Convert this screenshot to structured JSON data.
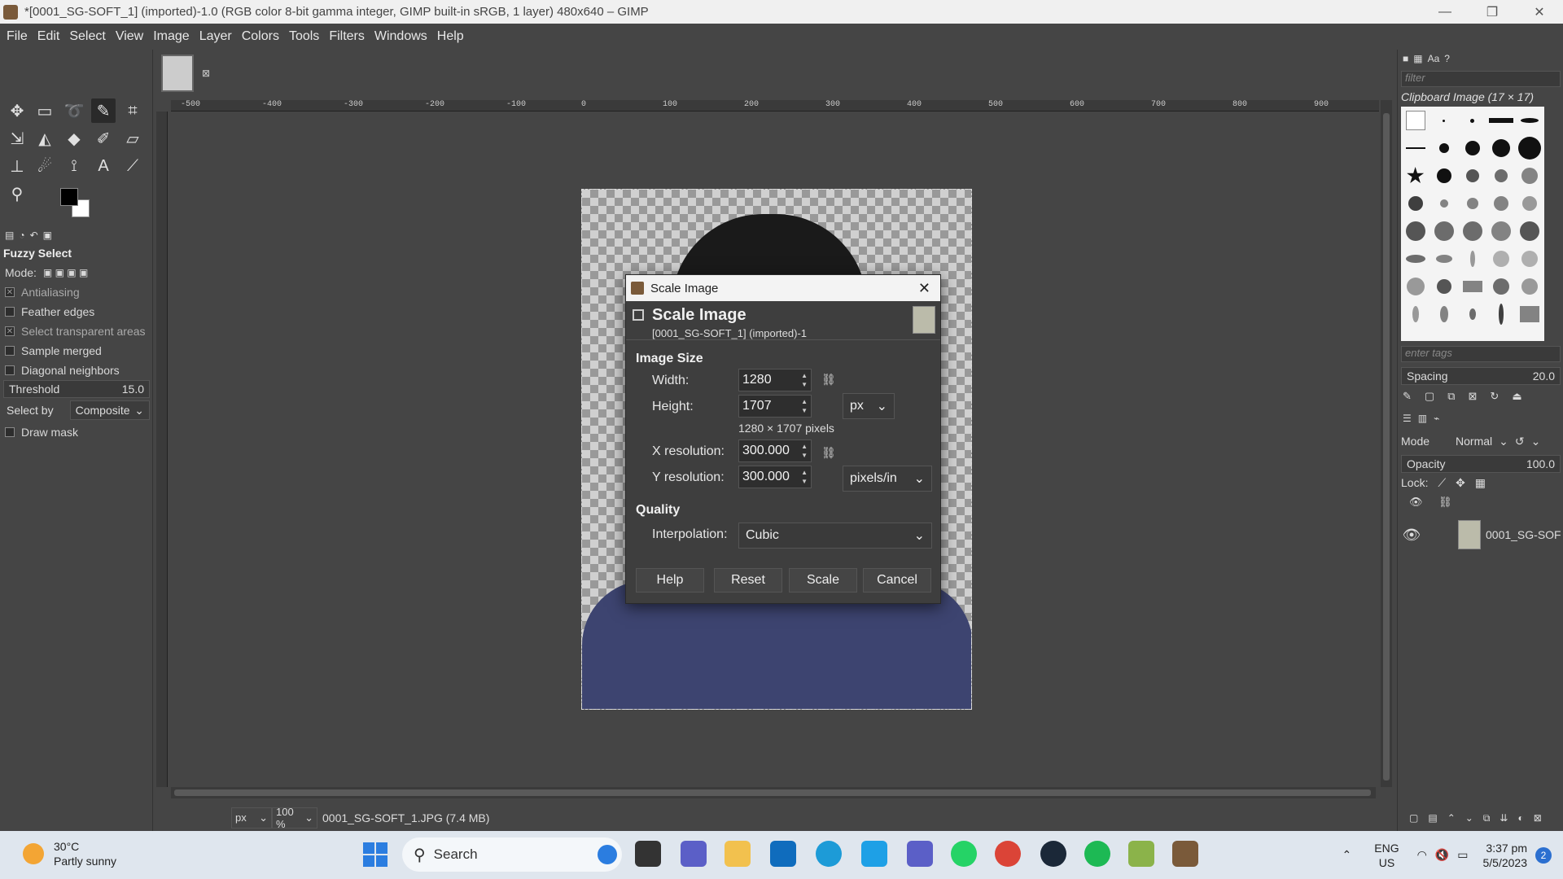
{
  "window": {
    "title": "*[0001_SG-SOFT_1] (imported)-1.0 (RGB color 8-bit gamma integer, GIMP built-in sRGB, 1 layer) 480x640 – GIMP",
    "minimize": "—",
    "maximize": "❐",
    "close": "✕"
  },
  "menu": [
    "File",
    "Edit",
    "Select",
    "View",
    "Image",
    "Layer",
    "Colors",
    "Tools",
    "Filters",
    "Windows",
    "Help"
  ],
  "tool_options": {
    "title": "Fuzzy Select",
    "mode_label": "Mode:",
    "antialiasing": "Antialiasing",
    "feather_edges": "Feather edges",
    "select_transparent": "Select transparent areas",
    "sample_merged": "Sample merged",
    "diagonal_neighbors": "Diagonal neighbors",
    "threshold_label": "Threshold",
    "threshold_value": "15.0",
    "select_by_label": "Select by",
    "select_by_value": "Composite",
    "draw_mask": "Draw mask"
  },
  "ruler_labels": [
    "-500",
    "-400",
    "-300",
    "-200",
    "-100",
    "0",
    "100",
    "200",
    "300",
    "400",
    "500",
    "600",
    "700",
    "800",
    "900"
  ],
  "status": {
    "unit": "px",
    "zoom": "100 %",
    "file": "0001_SG-SOFT_1.JPG (7.4 MB)"
  },
  "right_dock": {
    "filter_placeholder": "filter",
    "brush_name": "Clipboard Image (17 × 17)",
    "tags_placeholder": "enter tags",
    "spacing_label": "Spacing",
    "spacing_value": "20.0",
    "mode_label": "Mode",
    "mode_value": "Normal",
    "opacity_label": "Opacity",
    "opacity_value": "100.0",
    "lock_label": "Lock:",
    "layer_name": "0001_SG-SOF"
  },
  "dialog": {
    "window_title": "Scale Image",
    "header_title": "Scale Image",
    "header_subtitle": "[0001_SG-SOFT_1] (imported)-1",
    "image_size_label": "Image Size",
    "width_label": "Width:",
    "width_value": "1280",
    "height_label": "Height:",
    "height_value": "1707",
    "size_unit": "px",
    "pixels_note": "1280 × 1707 pixels",
    "xres_label": "X resolution:",
    "xres_value": "300.000",
    "yres_label": "Y resolution:",
    "yres_value": "300.000",
    "res_unit": "pixels/in",
    "quality_label": "Quality",
    "interp_label": "Interpolation:",
    "interp_value": "Cubic",
    "btn_help": "Help",
    "btn_reset": "Reset",
    "btn_scale": "Scale",
    "btn_cancel": "Cancel"
  },
  "taskbar": {
    "temp": "30°C",
    "weather": "Partly sunny",
    "search": "Search",
    "lang1": "ENG",
    "lang2": "US",
    "time": "3:37 pm",
    "date": "5/5/2023",
    "notif_count": "2"
  }
}
